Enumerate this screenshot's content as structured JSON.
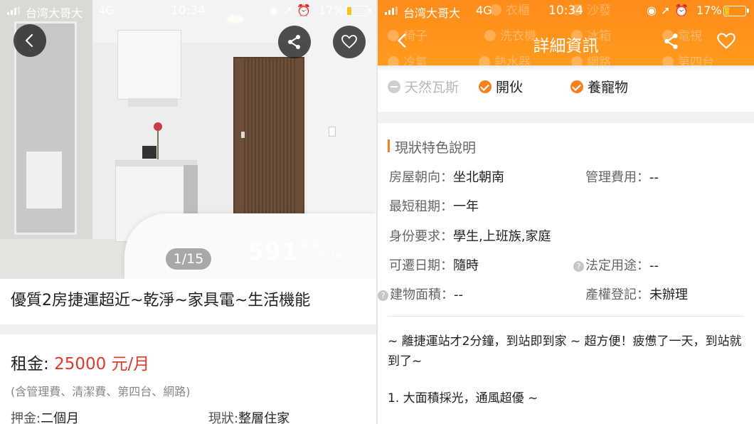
{
  "status_bar": {
    "carrier": "台湾大哥大",
    "network": "4G",
    "time": "10:34",
    "battery_percent": "17%"
  },
  "left": {
    "photo_counter": "1/15",
    "watermark": {
      "main": "591",
      "top": "房屋交易",
      "bottom": ".com.tw"
    },
    "listing_title": "優質2房捷運超近~乾淨~家具電~生活機能",
    "rent": {
      "label": "租金:",
      "value": "25000 元/月"
    },
    "rent_note": "(含管理費、清潔費、第四台、網路)",
    "deposit": {
      "label": "押金:",
      "value": "二個月"
    },
    "status": {
      "label": "現狀:",
      "value": "整層住家"
    },
    "icons": {
      "back": "back-arrow-icon",
      "share": "share-icon",
      "favorite": "heart-icon"
    }
  },
  "right": {
    "header_title": "詳細資訊",
    "faded_amenities": {
      "row1": [
        "衣櫃",
        "沙發"
      ],
      "row2": [
        "椅子",
        "洗衣機",
        "冰箱",
        "電視"
      ],
      "row3": [
        "冷氣",
        "熱水器",
        "網路",
        "第四台"
      ]
    },
    "amenities": [
      {
        "label": "天然瓦斯",
        "available": false
      },
      {
        "label": "開伙",
        "available": true
      },
      {
        "label": "養寵物",
        "available": true
      }
    ],
    "section_title": "現狀特色說明",
    "details": {
      "orientation": {
        "label": "房屋朝向：",
        "value": "坐北朝南"
      },
      "management_fee": {
        "label": "管理費用：",
        "value": "--"
      },
      "min_lease": {
        "label": "最短租期：",
        "value": "一年"
      },
      "identity": {
        "label": "身份要求：",
        "value": "學生,上班族,家庭"
      },
      "move_in": {
        "label": "可遷日期：",
        "value": "隨時"
      },
      "legal_use": {
        "label": "法定用途：",
        "value": "--"
      },
      "floor_area": {
        "label": "建物面積：",
        "value": "--"
      },
      "ownership": {
        "label": "產權登記：",
        "value": "未辦理"
      }
    },
    "description": "~ 離捷運站才2分鐘，到站即到家 ~ 超方便！疲憊了一天，到站就到了~",
    "feature_1": "1.  大面積採光，通風超優 ~"
  },
  "colors": {
    "accent": "#f5821f",
    "rent_red": "#e0392b",
    "header_orange": "#ff9019"
  }
}
